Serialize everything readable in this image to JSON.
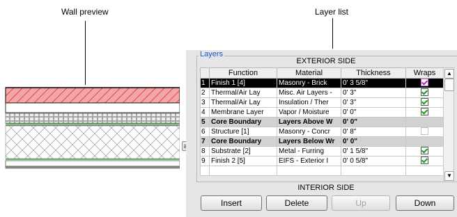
{
  "callouts": {
    "wall_preview": "Wall preview",
    "layer_list": "Layer list"
  },
  "panel": {
    "group_title": "Layers",
    "exterior_label": "EXTERIOR SIDE",
    "interior_label": "INTERIOR SIDE"
  },
  "table": {
    "columns": [
      "",
      "Function",
      "Material",
      "Thickness",
      "Wraps"
    ],
    "rows": [
      {
        "num": "1",
        "function": "Finish 1 [4]",
        "material": "Masonry - Brick",
        "thickness": "0'  3 5/8\"",
        "wraps": true,
        "selected": true
      },
      {
        "num": "2",
        "function": "Thermal/Air Lay",
        "material": "Misc. Air Layers -",
        "thickness": "0'  3\"",
        "wraps": true
      },
      {
        "num": "3",
        "function": "Thermal/Air Lay",
        "material": "Insulation / Ther",
        "thickness": "0'  3\"",
        "wraps": true
      },
      {
        "num": "4",
        "function": "Membrane Layer",
        "material": "Vapor / Moisture",
        "thickness": "0'  0\"",
        "wraps": true
      },
      {
        "num": "5",
        "function": "Core Boundary",
        "material": "Layers Above W",
        "thickness": "0'  0\"",
        "boundary": true
      },
      {
        "num": "6",
        "function": "Structure [1]",
        "material": "Masonry - Concr",
        "thickness": "0'  8\"",
        "wraps": false
      },
      {
        "num": "7",
        "function": "Core Boundary",
        "material": "Layers Below Wr",
        "thickness": "0'  0\"",
        "boundary": true
      },
      {
        "num": "8",
        "function": "Substrate [2]",
        "material": "Metal - Furring",
        "thickness": "0'  1 5/8\"",
        "wraps": true
      },
      {
        "num": "9",
        "function": "Finish 2 [5]",
        "material": "EIFS - Exterior I",
        "thickness": "0'  0 5/8\"",
        "wraps": true
      }
    ]
  },
  "buttons": {
    "insert": "Insert",
    "delete": "Delete",
    "up": "Up",
    "down": "Down"
  },
  "colors": {
    "brick_hatch": "#e8404f",
    "selection": "#000000",
    "group_title": "#1750c8",
    "membrane_line": "#2a9a2a"
  },
  "icons": {
    "expand": "expand-preview-icon",
    "scroll_up": "triangle-up",
    "scroll_down": "triangle-down"
  }
}
